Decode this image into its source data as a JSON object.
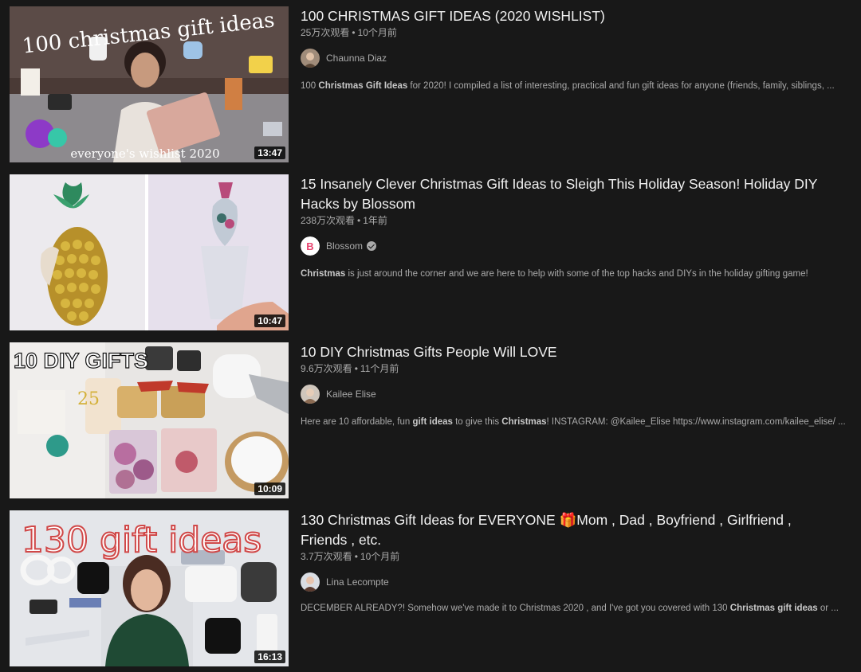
{
  "results": [
    {
      "title": "100 CHRISTMAS GIFT IDEAS (2020 WISHLIST)",
      "views": "25万次观看",
      "age": "10个月前",
      "channel": "Chaunna Diaz",
      "verified": false,
      "duration": "13:47",
      "thumb_text_top": "100 christmas gift ideas",
      "thumb_text_bottom": "everyone's wishlist 2020",
      "description": [
        {
          "t": "100 ",
          "b": false
        },
        {
          "t": "Christmas Gift Ideas",
          "b": true
        },
        {
          "t": " for 2020! I compiled a list of interesting, practical and fun gift ideas for anyone (friends, family, siblings, ...",
          "b": false
        }
      ]
    },
    {
      "title": "15 Insanely Clever Christmas Gift Ideas to Sleigh This Holiday Season! Holiday DIY Hacks by Blossom",
      "views": "238万次观看",
      "age": "1年前",
      "channel": "Blossom",
      "verified": true,
      "duration": "10:47",
      "description": [
        {
          "t": "Christmas",
          "b": true
        },
        {
          "t": " is just around the corner and we are here to help with some of the top hacks and DIYs in the holiday gifting game!",
          "b": false
        }
      ]
    },
    {
      "title": "10 DIY Christmas Gifts People Will LOVE",
      "views": "9.6万次观看",
      "age": "11个月前",
      "channel": "Kailee Elise",
      "verified": false,
      "duration": "10:09",
      "thumb_text_top": "10 DIY GIFTS",
      "description": [
        {
          "t": "Here are 10 affordable, fun ",
          "b": false
        },
        {
          "t": "gift ideas",
          "b": true
        },
        {
          "t": " to give this ",
          "b": false
        },
        {
          "t": "Christmas",
          "b": true
        },
        {
          "t": "! INSTAGRAM: @Kailee_Elise https://www.instagram.com/kailee_elise/ ...",
          "b": false
        }
      ]
    },
    {
      "title": "130 Christmas Gift Ideas for EVERYONE 🎁Mom , Dad , Boyfriend , Girlfriend , Friends , etc.",
      "views": "3.7万次观看",
      "age": "10个月前",
      "channel": "Lina Lecompte",
      "verified": false,
      "duration": "16:13",
      "thumb_text_top": "130 gift ideas",
      "description": [
        {
          "t": "DECEMBER ALREADY?! Somehow we've made it to Christmas 2020 , and I've got you covered with 130 ",
          "b": false
        },
        {
          "t": "Christmas gift ideas",
          "b": true
        },
        {
          "t": " or ...",
          "b": false
        }
      ]
    }
  ],
  "colors": {
    "background": "#181818",
    "title": "#f1f1f1",
    "secondary": "#aaaaaa"
  }
}
